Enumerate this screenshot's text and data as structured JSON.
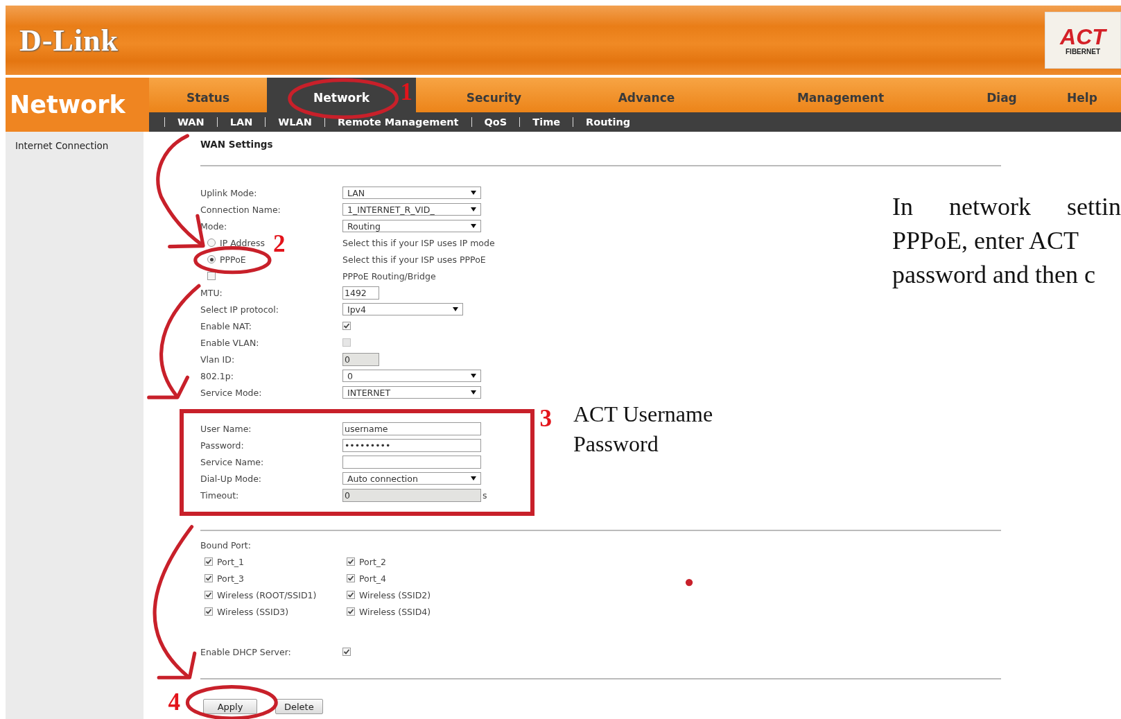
{
  "header": {
    "brand": "D-Link",
    "logo": {
      "title": "ACT",
      "subtitle": "FIBERNET"
    }
  },
  "section_title": "Network",
  "tabs": [
    {
      "label": "Status",
      "selected": false
    },
    {
      "label": "Network",
      "selected": true
    },
    {
      "label": "Security",
      "selected": false
    },
    {
      "label": "Advance",
      "selected": false
    },
    {
      "label": "Management",
      "selected": false
    },
    {
      "label": "Diag",
      "selected": false
    },
    {
      "label": "Help",
      "selected": false
    }
  ],
  "subtabs": [
    "WAN",
    "LAN",
    "WLAN",
    "Remote Management",
    "QoS",
    "Time",
    "Routing"
  ],
  "sidebar": {
    "items": [
      {
        "label": "Internet Connection"
      }
    ]
  },
  "form": {
    "title": "WAN Settings",
    "rows": [
      {
        "kind": "select",
        "label": "Uplink Mode:",
        "value": "LAN",
        "disabled": false
      },
      {
        "kind": "select",
        "label": "Connection Name:",
        "value": "1_INTERNET_R_VID_",
        "disabled": false
      },
      {
        "kind": "select",
        "label": "Mode:",
        "value": "Routing",
        "disabled": false
      },
      {
        "kind": "radio",
        "label": "IP Address",
        "hint": "Select this if your ISP uses IP mode",
        "selected": false,
        "disabled": false
      },
      {
        "kind": "radio",
        "label": "PPPoE",
        "hint": "Select this if your ISP uses PPPoE",
        "selected": true,
        "disabled": false
      },
      {
        "kind": "option",
        "hint": "PPPoE Routing/Bridge",
        "checked": false,
        "disabled": false
      },
      {
        "kind": "input",
        "label": "MTU:",
        "value": "1492",
        "disabled": false
      },
      {
        "kind": "select",
        "label": "Select IP protocol:",
        "value": "Ipv4",
        "disabled": false
      },
      {
        "kind": "checkbox",
        "label": "Enable NAT:",
        "checked": true,
        "disabled": false
      },
      {
        "kind": "checkbox",
        "label": "Enable VLAN:",
        "checked": false,
        "disabled": true
      },
      {
        "kind": "input",
        "label": "Vlan ID:",
        "value": "0",
        "disabled": true
      },
      {
        "kind": "select",
        "label": "802.1p:",
        "value": "0",
        "disabled": false
      },
      {
        "kind": "select",
        "label": "Service Mode:",
        "value": "INTERNET",
        "disabled": false
      }
    ],
    "pppoe_rows": [
      {
        "kind": "input",
        "label": "User Name:",
        "value": "username",
        "disabled": false
      },
      {
        "kind": "input",
        "label": "Password:",
        "value": "•••••••••",
        "disabled": false
      },
      {
        "kind": "input",
        "label": "Service Name:",
        "disabled": false
      },
      {
        "kind": "select",
        "label": "Dial-Up Mode:",
        "value": "Auto connection",
        "disabled": false
      },
      {
        "kind": "input",
        "label": "Timeout:",
        "value": "0",
        "suffix": "s",
        "disabled": true
      }
    ],
    "bound_port": {
      "label": "Bound Port:",
      "ports": [
        {
          "label": "Port_1",
          "checked": true
        },
        {
          "label": "Port_2",
          "checked": true
        },
        {
          "label": "Port_3",
          "checked": true
        },
        {
          "label": "Port_4",
          "checked": true
        },
        {
          "label": "Wireless (ROOT/SSID1)",
          "checked": true
        },
        {
          "label": "Wireless (SSID2)",
          "checked": true
        },
        {
          "label": "Wireless (SSID3)",
          "checked": true
        },
        {
          "label": "Wireless (SSID4)",
          "checked": true
        }
      ]
    },
    "dhcp": {
      "label": "Enable DHCP Server:",
      "checked": true
    },
    "buttons": [
      {
        "label": "Apply"
      },
      {
        "label": "Delete"
      }
    ]
  },
  "annotations": {
    "steps": [
      "1",
      "2",
      "3",
      "4"
    ],
    "credentials_note": [
      "ACT Username",
      "Password"
    ],
    "instructions": [
      "In network settin",
      "PPPoE, enter ACT",
      "password and then c"
    ]
  }
}
